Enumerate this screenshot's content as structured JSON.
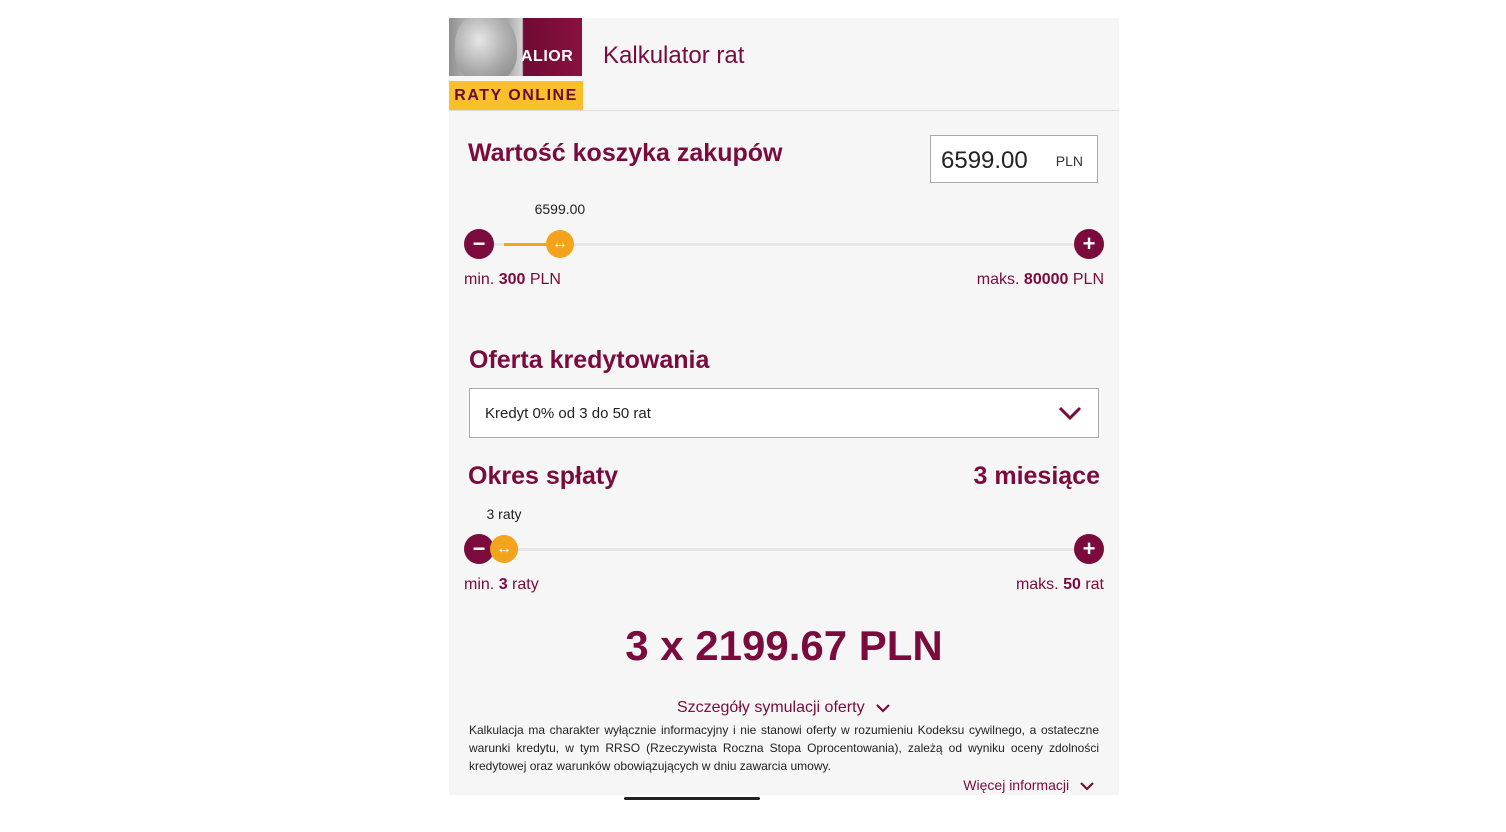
{
  "header": {
    "logo_word": "ALIOR",
    "logo_sub": "RATY ONLINE",
    "title": "Kalkulator rat"
  },
  "basket": {
    "heading": "Wartość koszyka zakupów",
    "value": "6599.00",
    "unit": "PLN",
    "bubble": "6599.00",
    "min_prefix": "min.",
    "min_value": "300",
    "min_unit": "PLN",
    "max_prefix": "maks.",
    "max_value": "80000",
    "max_unit": "PLN",
    "fraction": 0.0788
  },
  "offer": {
    "heading": "Oferta kredytowania",
    "selected": "Kredyt 0% od 3 do 50 rat"
  },
  "period": {
    "heading": "Okres spłaty",
    "value_text": "3 miesiące",
    "bubble": "3 raty",
    "min_prefix": "min.",
    "min_value": "3",
    "min_unit": "raty",
    "max_prefix": "maks.",
    "max_value": "50",
    "max_unit": "rat",
    "fraction": 0
  },
  "result": {
    "text": "3 x 2199.67 PLN"
  },
  "details_link": "Szczegóły symulacji oferty",
  "disclaimer": "Kalkulacja ma charakter wyłącznie informacyjny i nie stanowi oferty w rozumieniu Kodeksu cywilnego, a ostateczne warunki kredytu, w tym RRSO (Rzeczywista Roczna Stopa Oprocentowania), zależą od wyniku oceny zdolności kredytowej oraz warunków obowiązujących w dniu zawarcia umowy.",
  "more_link": "Więcej informacji",
  "colors": {
    "brand": "#7a0b3c",
    "accent": "#f3a31c",
    "logo_yellow": "#f9c02b"
  },
  "icons": {
    "minus": "minus-icon",
    "plus": "plus-icon",
    "knob": "arrows-horizontal-icon",
    "dropdown": "chevron-down-icon"
  }
}
